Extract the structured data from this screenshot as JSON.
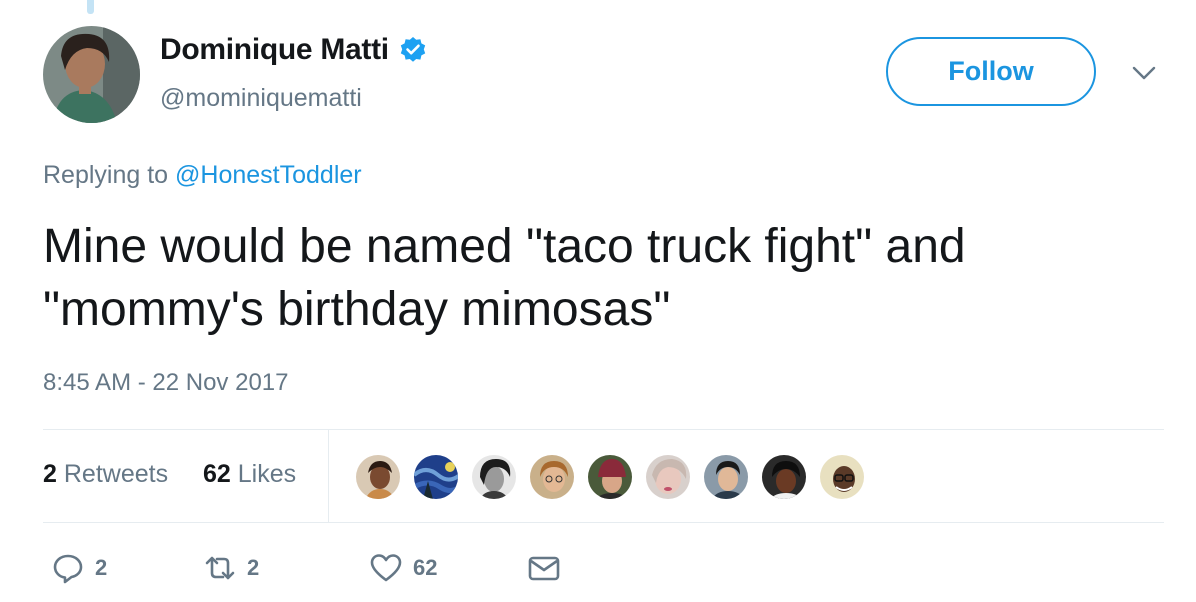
{
  "author": {
    "display_name": "Dominique Matti",
    "handle": "@mominiquematti",
    "verified": true
  },
  "follow_button": {
    "label": "Follow"
  },
  "reply_context": {
    "prefix": "Replying to",
    "mention": "@HonestToddler"
  },
  "tweet": {
    "text_line1": "Mine would be named \"taco truck fight\" and",
    "text_line2": "\"mommy's birthday mimosas\"",
    "timestamp": "8:45 AM - 22 Nov 2017"
  },
  "stats": {
    "retweets_count": "2",
    "retweets_label": "Retweets",
    "likes_count": "62",
    "likes_label": "Likes"
  },
  "actions": {
    "reply_count": "2",
    "retweet_count": "2",
    "like_count": "62"
  },
  "colors": {
    "accent": "#1b95e0",
    "text": "#14171a",
    "secondary": "#657786",
    "divider": "#e6ecf0"
  }
}
